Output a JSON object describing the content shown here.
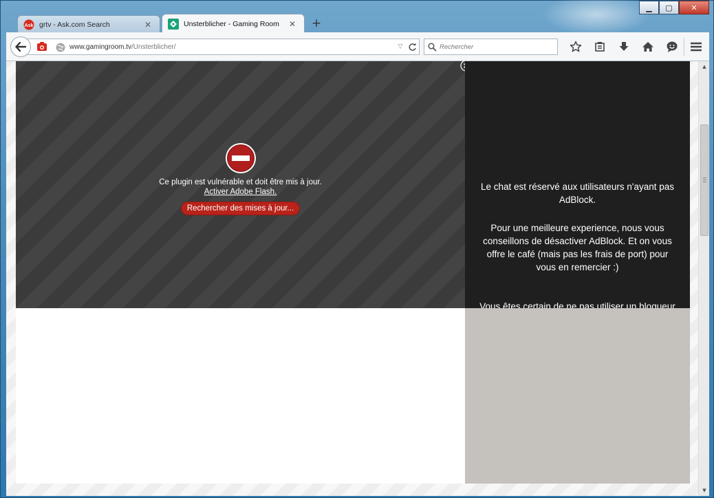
{
  "window": {
    "caption": {
      "minimize": "▁",
      "maximize": "▢",
      "close": "✕"
    }
  },
  "tabs": [
    {
      "label": "grtv - Ask.com Search",
      "favicon": "ask-icon",
      "active": false
    },
    {
      "label": "Unsterblicher - Gaming Room",
      "favicon": "gamingroom-icon",
      "active": true
    }
  ],
  "new_tab_label": "+",
  "navbar": {
    "url_domain": "www.gamingroom.tv",
    "url_path": "/Unsterblicher/",
    "search_placeholder": "Rechercher"
  },
  "plugin": {
    "message": "Ce plugin est vulnérable et doit être mis à jour.",
    "activate_link": "Activer Adobe Flash.",
    "update_button": "Rechercher des mises à jour..."
  },
  "chat": {
    "paragraph1": "Le chat est réservé aux utilisateurs n'ayant pas AdBlock.",
    "paragraph2": "Pour une meilleure experience, nous vous conseillons de désactiver AdBlock. Et on vous offre le café (mais pas les frais de port) pour vous en remercier :)",
    "paragraph3": "Vous êtes certain de ne pas utiliser un bloqueur"
  },
  "colors": {
    "update_button": "#b9231a",
    "chat_bg": "#1f1f1f",
    "chat_lower_bg": "#c5c1bd"
  }
}
